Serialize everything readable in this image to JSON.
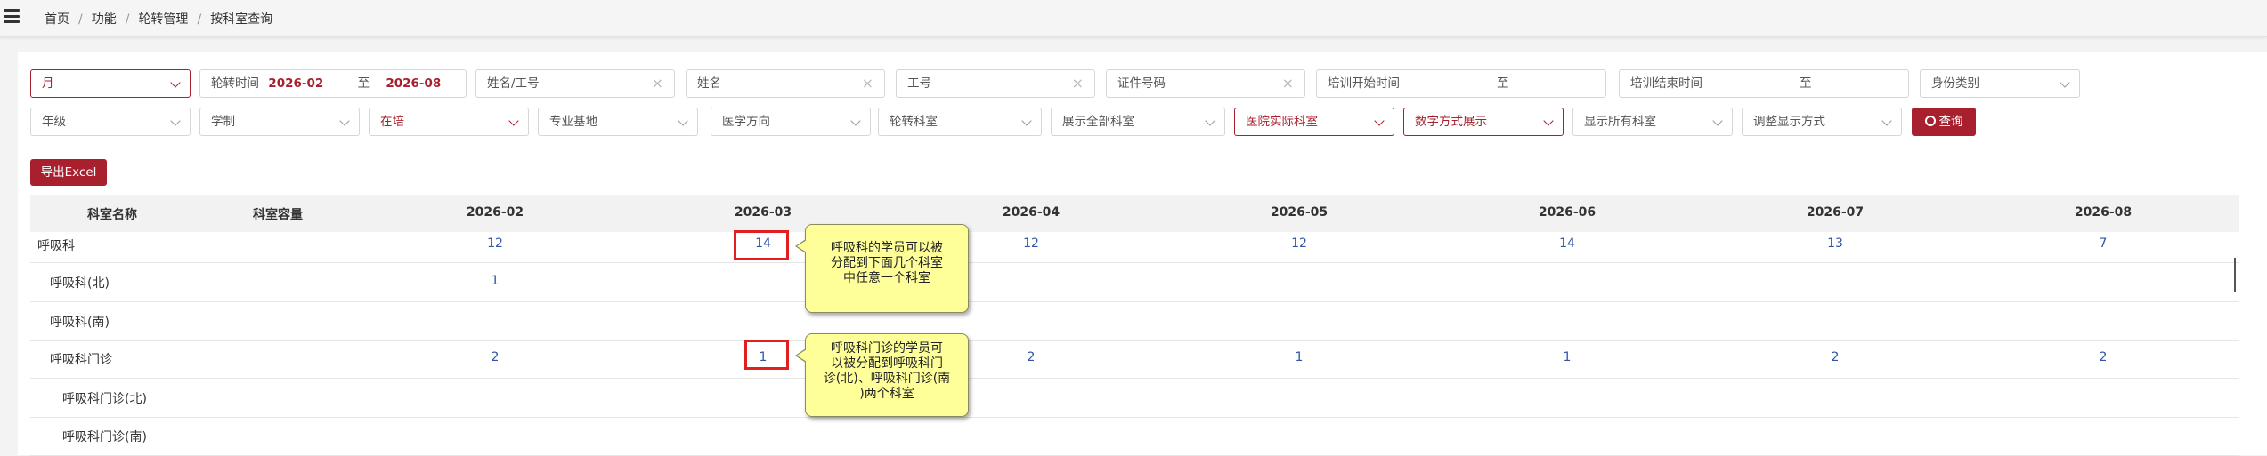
{
  "breadcrumb": [
    "首页",
    "功能",
    "轮转管理",
    "按科室查询"
  ],
  "filters": {
    "period": "月",
    "rotation_label": "轮转时间",
    "rotation_start": "2026-02",
    "rotation_to": "至",
    "rotation_end": "2026-08",
    "name_or_id": "姓名/工号",
    "name": "姓名",
    "staff_id": "工号",
    "id_number": "证件号码",
    "train_start": "培训开始时间",
    "train_start_to": "至",
    "train_end": "培训结束时间",
    "train_end_to": "至",
    "identity": "身份类别",
    "grade": "年级",
    "program": "学制",
    "status": "在培",
    "base": "专业基地",
    "direction": "医学方向",
    "rotation_dept": "轮转科室",
    "show_all_depts": "展示全部科室",
    "actual_dept": "医院实际科室",
    "number_display": "数字方式展示",
    "show_all_rooms": "显示所有科室",
    "adjust_display": "调整显示方式",
    "search": "查询"
  },
  "export_label": "导出Excel",
  "table": {
    "col_name": "科室名称",
    "col_capacity": "科室容量",
    "months": [
      "2026-02",
      "2026-03",
      "2026-04",
      "2026-05",
      "2026-06",
      "2026-07",
      "2026-08"
    ],
    "rows": [
      {
        "name": "呼吸科",
        "capacity": "",
        "values": [
          "12",
          "14",
          "12",
          "12",
          "14",
          "13",
          "7"
        ]
      },
      {
        "name": "呼吸科(北)",
        "capacity": "",
        "values": [
          "1",
          "",
          "",
          "",
          "",
          "",
          ""
        ]
      },
      {
        "name": "呼吸科(南)",
        "capacity": "",
        "values": [
          "",
          "",
          "",
          "",
          "",
          "",
          ""
        ]
      },
      {
        "name": "呼吸科门诊",
        "capacity": "",
        "values": [
          "2",
          "1",
          "2",
          "1",
          "1",
          "2",
          "2"
        ]
      },
      {
        "name": "呼吸科门诊(北)",
        "capacity": "",
        "values": [
          "",
          "",
          "",
          "",
          "",
          "",
          ""
        ]
      },
      {
        "name": "呼吸科门诊(南)",
        "capacity": "",
        "values": [
          "",
          "",
          "",
          "",
          "",
          "",
          ""
        ]
      }
    ]
  },
  "callouts": [
    {
      "lines": [
        "呼吸科的学员可以被",
        "分配到下面几个科室",
        "中任意一个科室"
      ]
    },
    {
      "lines": [
        "呼吸科门诊的学员可",
        "以被分配到呼吸科门",
        "诊(北)、呼吸科门诊(南",
        ")两个科室"
      ]
    }
  ],
  "colors": {
    "accent": "#a8202e",
    "link": "#2f55a4",
    "callout": "#ffff99",
    "highlight": "#e02020"
  }
}
